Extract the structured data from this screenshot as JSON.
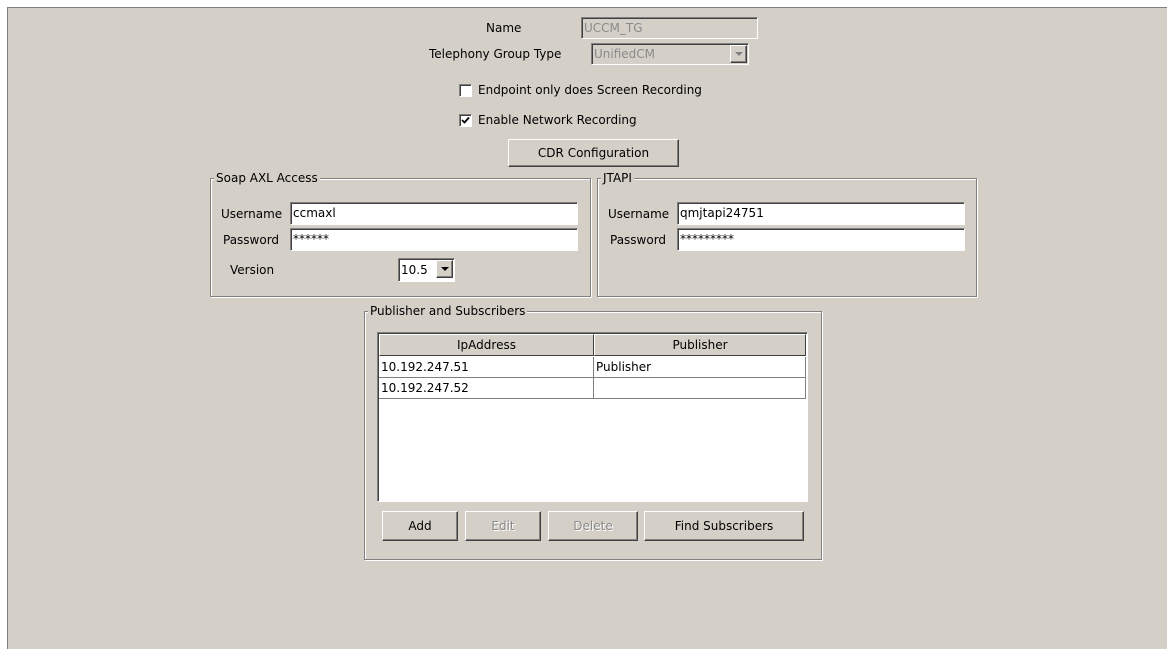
{
  "general": {
    "name_label": "Name",
    "name_value": "UCCM_TG",
    "telephony_type_label": "Telephony Group Type",
    "telephony_type_value": "UnifiedCM",
    "screen_recording_label": "Endpoint only does Screen Recording",
    "screen_recording_checked": false,
    "network_recording_label": "Enable Network Recording",
    "network_recording_checked": true,
    "cdr_button": "CDR Configuration"
  },
  "soap_axl": {
    "title": "Soap AXL Access",
    "username_label": "Username",
    "username_value": "ccmaxl",
    "password_label": "Password",
    "password_value": "******",
    "version_label": "Version",
    "version_value": "10.5"
  },
  "jtapi": {
    "title": "JTAPI",
    "username_label": "Username",
    "username_value": "qmjtapi24751",
    "password_label": "Password",
    "password_value": "*********"
  },
  "publishers": {
    "title": "Publisher and Subscribers",
    "columns": [
      "IpAddress",
      "Publisher"
    ],
    "rows": [
      {
        "ip": "10.192.247.51",
        "role": "Publisher"
      },
      {
        "ip": "10.192.247.52",
        "role": ""
      }
    ],
    "buttons": {
      "add": "Add",
      "edit": "Edit",
      "delete": "Delete",
      "find": "Find Subscribers"
    }
  },
  "colors": {
    "panel_bg": "#d4d0c8",
    "border_dark": "#808080",
    "disabled_text": "#8a8a8a"
  }
}
